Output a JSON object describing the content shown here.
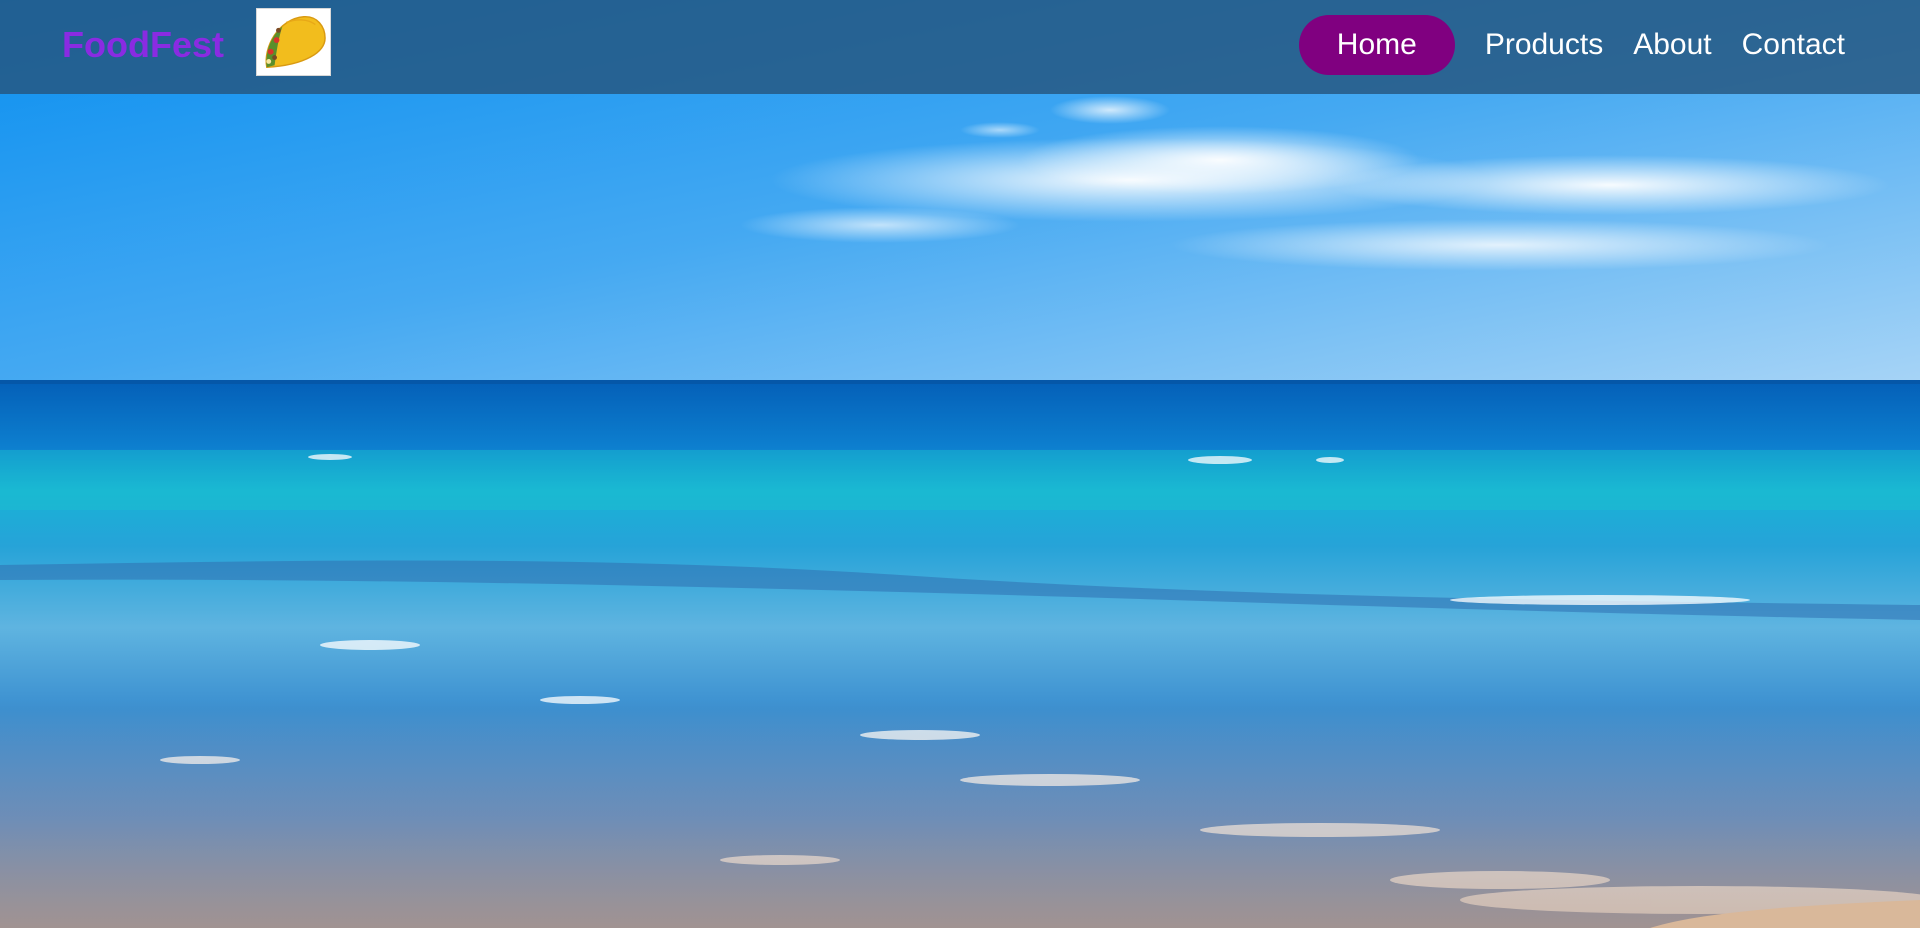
{
  "header": {
    "brand": "FoodFest",
    "logo_icon": "taco-icon"
  },
  "nav": {
    "items": [
      {
        "label": "Home",
        "active": true
      },
      {
        "label": "Products",
        "active": false
      },
      {
        "label": "About",
        "active": false
      },
      {
        "label": "Contact",
        "active": false
      }
    ]
  },
  "hero": {
    "image": "ocean-beach-background"
  },
  "colors": {
    "brand_text": "#8a2be2",
    "nav_background": "#26567e",
    "active_pill": "#800080",
    "nav_text": "#ffffff"
  }
}
